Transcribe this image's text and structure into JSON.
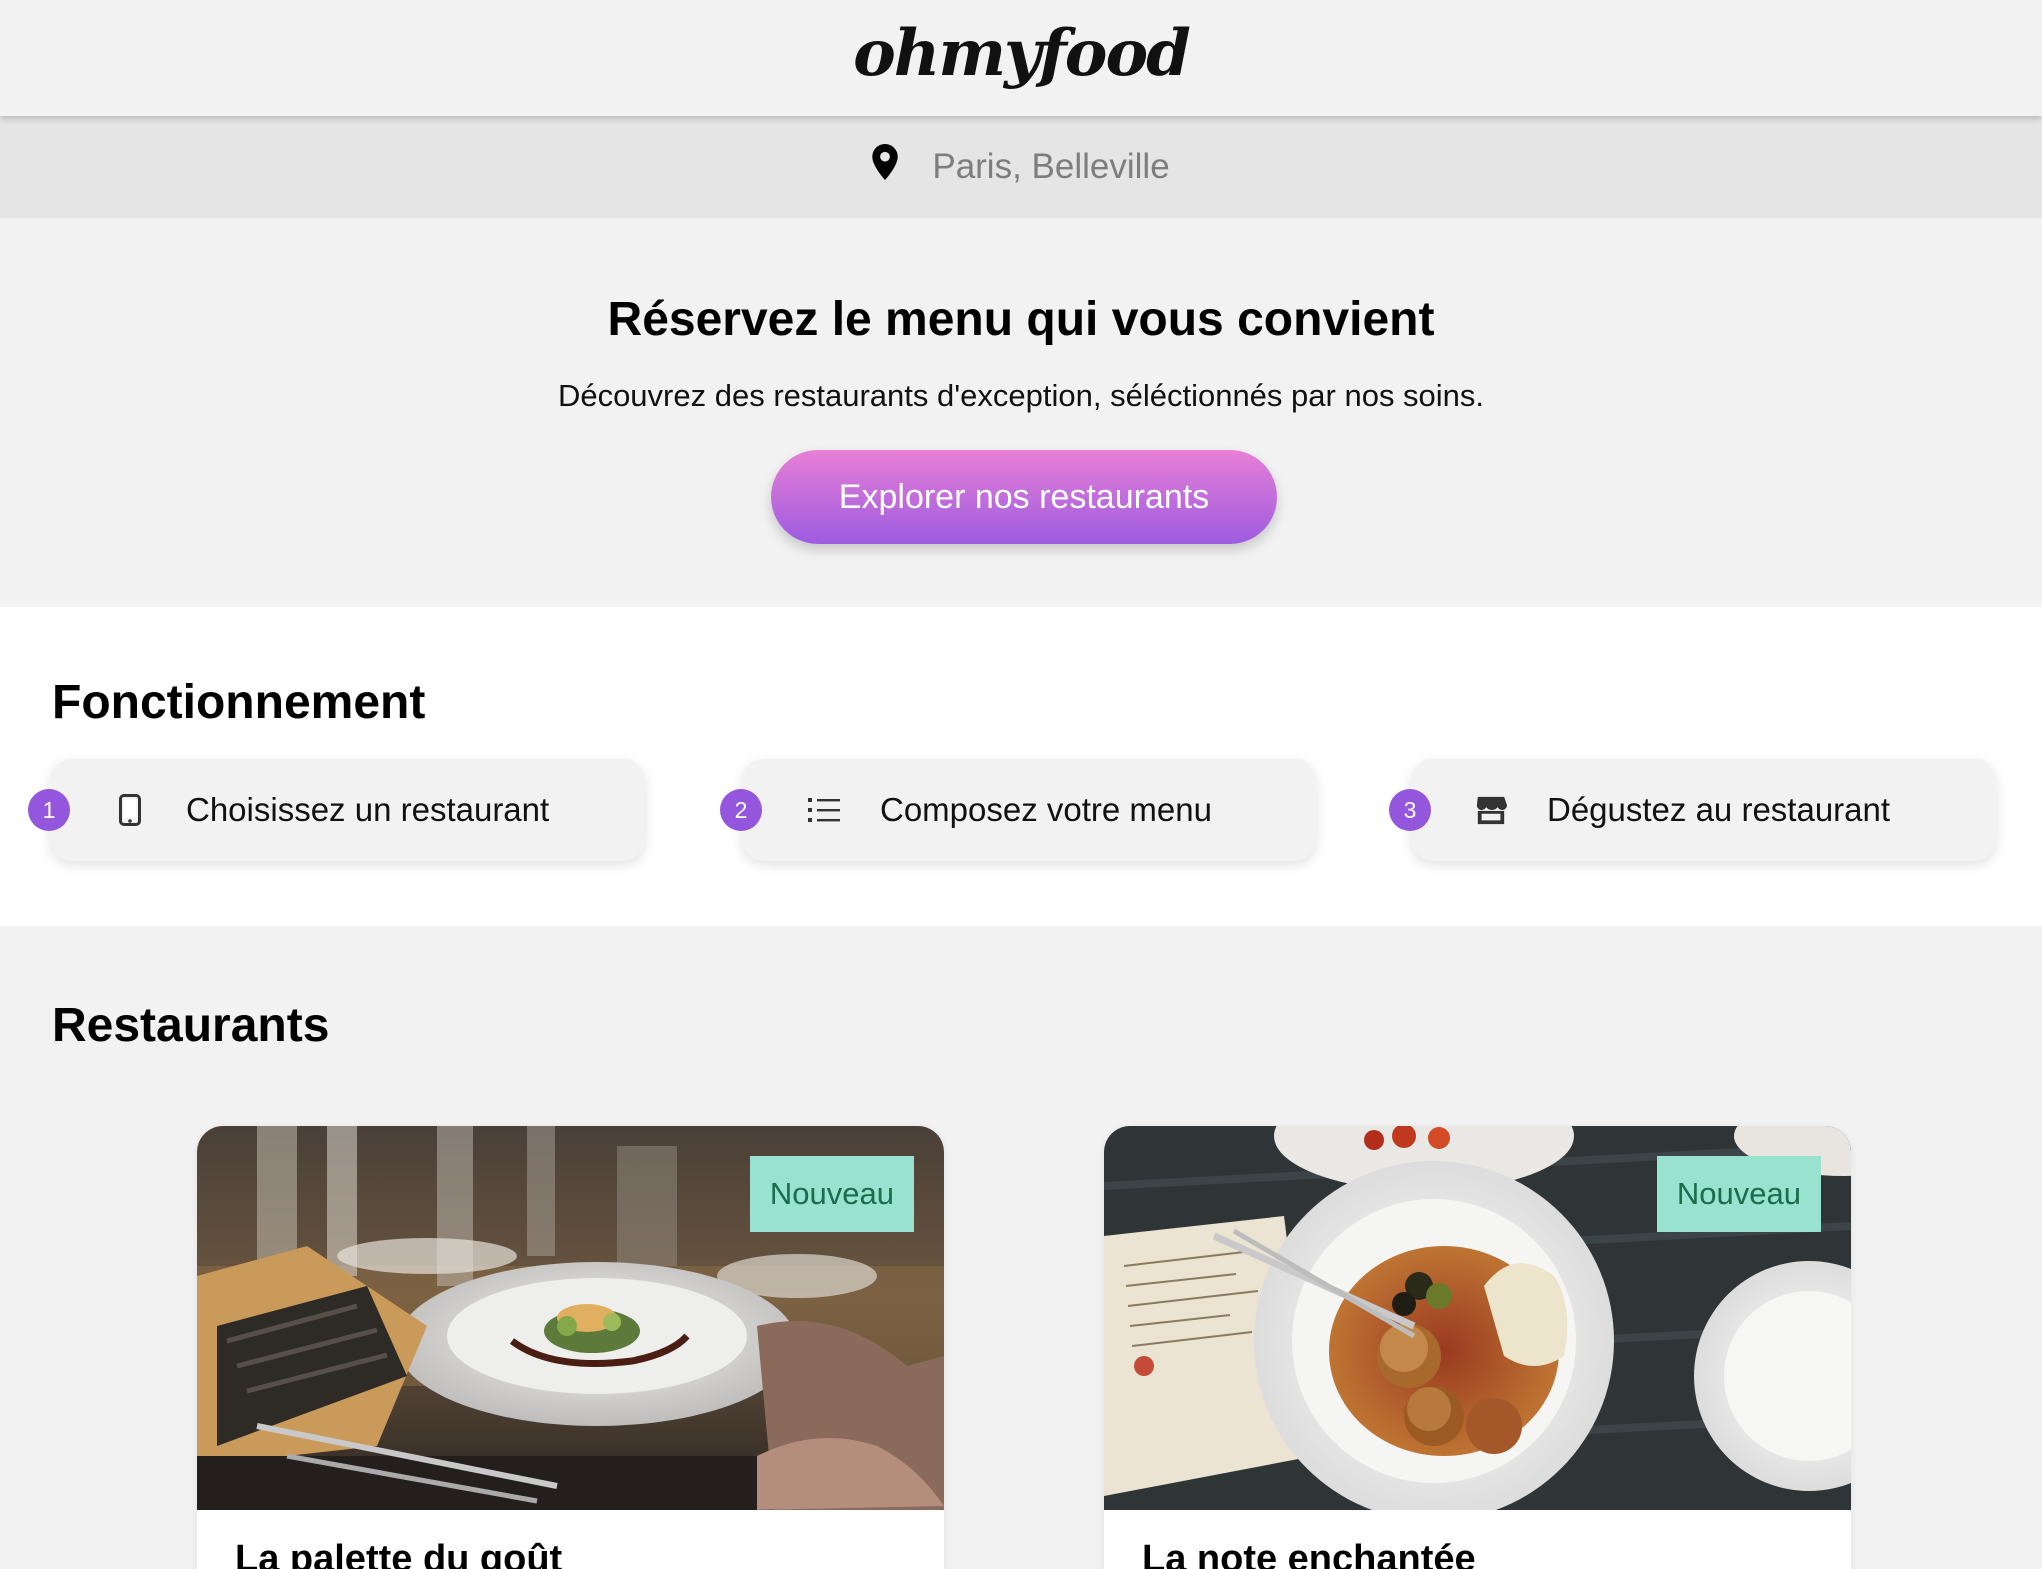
{
  "header": {
    "logo": "ohmyfood"
  },
  "location": {
    "icon": "map-pin-icon",
    "text": "Paris, Belleville"
  },
  "hero": {
    "title": "Réservez le menu qui vous convient",
    "subtitle": "Découvrez des restaurants d'exception, séléctionnés par nos soins.",
    "cta_label": "Explorer nos restaurants"
  },
  "how_it_works": {
    "title": "Fonctionnement",
    "steps": [
      {
        "number": "1",
        "icon": "mobile-phone-icon",
        "label": "Choisissez un restaurant"
      },
      {
        "number": "2",
        "icon": "list-icon",
        "label": "Composez votre menu"
      },
      {
        "number": "3",
        "icon": "store-icon",
        "label": "Dégustez au restaurant"
      }
    ]
  },
  "restaurants": {
    "title": "Restaurants",
    "cards": [
      {
        "badge": "Nouveau",
        "name": "La palette du goût"
      },
      {
        "badge": "Nouveau",
        "name": "La note enchantée"
      }
    ]
  },
  "colors": {
    "accent_purple": "#9356dc",
    "cta_gradient_top": "#e77fd6",
    "cta_gradient_bottom": "#9d5ce0",
    "badge_bg": "#99e2d0",
    "badge_text": "#1c6b4d",
    "page_bg": "#f2f2f2"
  }
}
